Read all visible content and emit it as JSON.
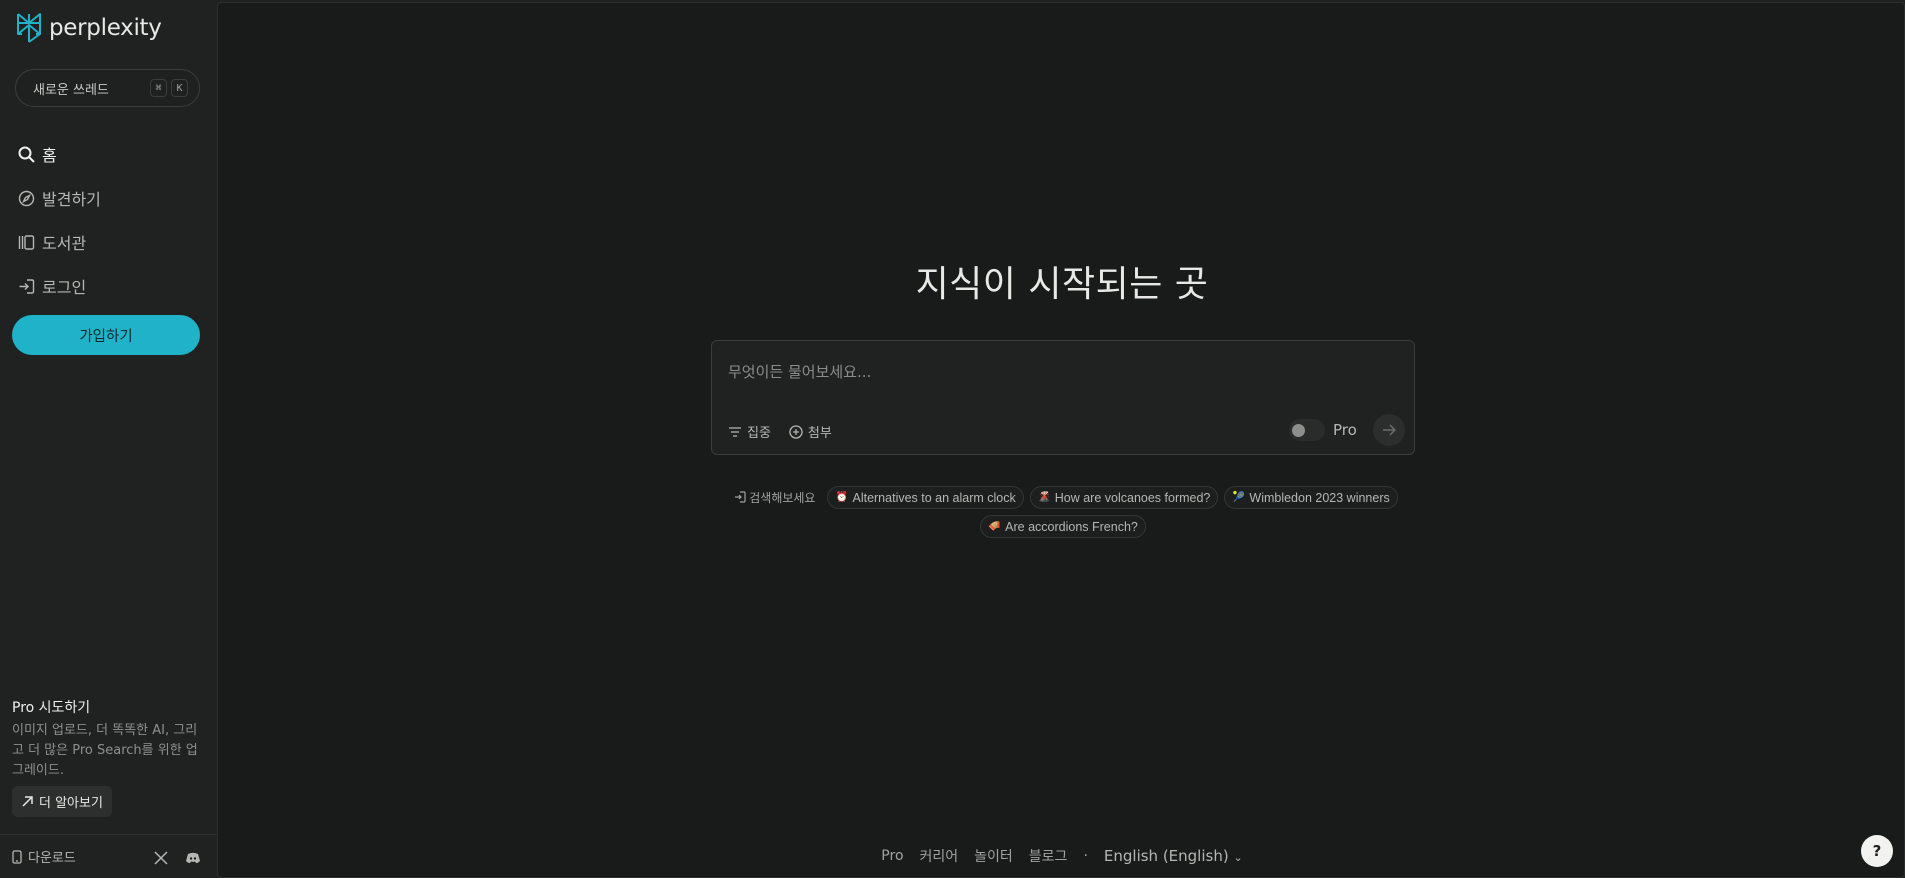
{
  "brand": {
    "name": "perplexity",
    "accent": "#20b2c8"
  },
  "sidebar": {
    "new_thread": {
      "label": "새로운 쓰레드",
      "shortcut_keys": [
        "⌘",
        "K"
      ]
    },
    "nav": [
      {
        "label": "홈",
        "icon": "search-icon"
      },
      {
        "label": "발견하기",
        "icon": "compass-icon"
      },
      {
        "label": "도서관",
        "icon": "library-icon"
      },
      {
        "label": "로그인",
        "icon": "login-icon"
      }
    ],
    "signup_label": "가입하기",
    "pro": {
      "title": "Pro 시도하기",
      "description": "이미지 업로드, 더 똑똑한 AI, 그리고 더 많은 Pro Search를 위한 업그레이드.",
      "learn_more": "더 알아보기"
    },
    "footer": {
      "download_label": "다운로드"
    }
  },
  "main": {
    "headline": "지식이 시작되는 곳",
    "search": {
      "placeholder": "무엇이든 물어보세요...",
      "focus_label": "집중",
      "attach_label": "첨부",
      "pro_label": "Pro",
      "pro_enabled": false
    },
    "suggestions": {
      "label": "검색해보세요",
      "items": [
        {
          "text": "Alternatives to an alarm clock",
          "icon": "⏰",
          "icon_color": "#d8d8d8"
        },
        {
          "text": "How are volcanoes formed?",
          "icon": "🌋",
          "icon_color": "#9c8f85"
        },
        {
          "text": "Wimbledon 2023 winners",
          "icon": "🎾",
          "icon_color": "#b7b7a8"
        },
        {
          "text": "Are accordions French?",
          "icon": "🪗",
          "icon_color": "#5a5a5a"
        }
      ]
    },
    "footer": {
      "links": [
        "Pro",
        "커리어",
        "놀이터",
        "블로그"
      ],
      "separator": "·",
      "language": "English (English)"
    },
    "help_label": "?"
  }
}
